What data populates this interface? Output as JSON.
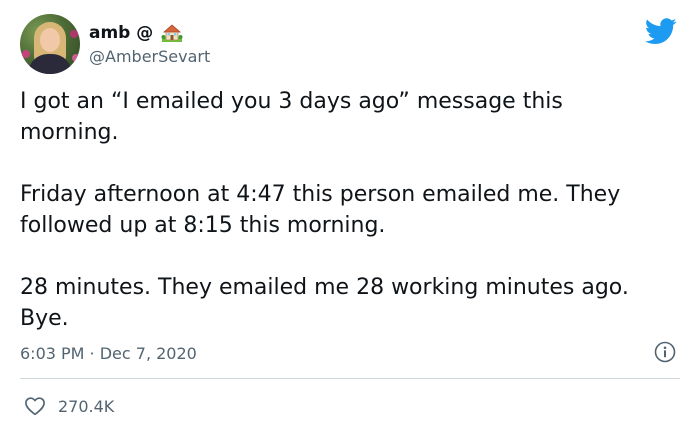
{
  "author": {
    "display_name": "amb @",
    "handle": "@AmberSevart",
    "name_emoji_icon": "house-with-garden-icon"
  },
  "tweet": {
    "paragraphs": [
      "I got an “I emailed you 3 days ago” message this morning.",
      "Friday afternoon at 4:47 this person emailed me. They followed up at 8:15 this morning.",
      "28 minutes. They emailed me 28 working minutes ago. Bye."
    ],
    "timestamp": "6:03 PM · Dec 7, 2020"
  },
  "engagement": {
    "likes": "270.4K"
  },
  "icons": {
    "brand": "twitter-bird-icon",
    "info": "info-icon",
    "like": "heart-icon"
  },
  "colors": {
    "brand_blue": "#1d9bf0",
    "secondary_text": "#536471",
    "primary_text": "#0f1419",
    "divider": "#cfd9de"
  }
}
